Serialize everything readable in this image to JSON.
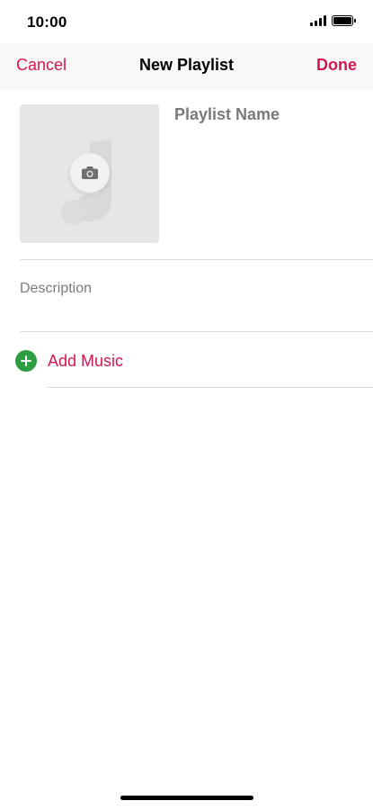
{
  "status_bar": {
    "time": "10:00",
    "signal_icon": "cellular-signal-icon",
    "battery_icon": "battery-full-icon"
  },
  "nav": {
    "cancel_label": "Cancel",
    "title": "New Playlist",
    "done_label": "Done"
  },
  "artwork": {
    "placeholder_icon": "music-note-icon",
    "camera_icon": "camera-icon"
  },
  "playlist_name_placeholder": "Playlist Name",
  "description_placeholder": "Description",
  "add_music": {
    "label": "Add Music",
    "icon": "plus-circle-icon"
  },
  "colors": {
    "accent": "#d1184f",
    "add_green": "#2e9e42",
    "placeholder_gray": "#7a7a7a",
    "artwork_bg": "#e6e6e6"
  }
}
